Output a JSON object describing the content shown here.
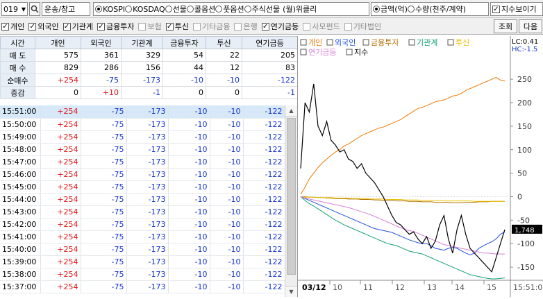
{
  "toolbar": {
    "code": "019",
    "sector": "운송/창고",
    "markets": [
      "KOSPI",
      "KOSDAQ",
      "선물",
      "콜옵션",
      "풋옵션",
      "주식선물",
      "(월)위클리"
    ],
    "selected_market": "KOSPI",
    "units": [
      "금액(억)",
      "수량(천주/계약)"
    ],
    "selected_unit": "금액(억)",
    "show_index_label": "지수보이기",
    "show_index_checked": true,
    "query_button": "조회",
    "next_button": "다음"
  },
  "investor_filters": [
    {
      "label": "개인",
      "checked": true
    },
    {
      "label": "외국인",
      "checked": true
    },
    {
      "label": "기관계",
      "checked": true
    },
    {
      "label": "금융투자",
      "checked": true
    },
    {
      "label": "보험",
      "checked": false
    },
    {
      "label": "투신",
      "checked": true
    },
    {
      "label": "기타금융",
      "checked": false
    },
    {
      "label": "은행",
      "checked": false
    },
    {
      "label": "연기금등",
      "checked": true
    },
    {
      "label": "사모펀드",
      "checked": false
    },
    {
      "label": "기타법인",
      "checked": false
    }
  ],
  "summary": {
    "headers": [
      "시간",
      "개인",
      "외국인",
      "기관계",
      "금융투자",
      "투신",
      "연기금등"
    ],
    "rows": [
      {
        "label": "매 도",
        "values": [
          "575",
          "361",
          "329",
          "54",
          "22",
          "205"
        ]
      },
      {
        "label": "매 수",
        "values": [
          "829",
          "286",
          "156",
          "44",
          "12",
          "83"
        ]
      },
      {
        "label": "순매수",
        "values": [
          "+254",
          "-75",
          "-173",
          "-10",
          "-10",
          "-122"
        ]
      },
      {
        "label": "증감",
        "values": [
          "0",
          "+10",
          "-1",
          "0",
          "0",
          "-1"
        ]
      }
    ]
  },
  "time_rows": {
    "times": [
      "15:51:00",
      "15:50:00",
      "15:49:00",
      "15:48:00",
      "15:47:00",
      "15:46:00",
      "15:45:00",
      "15:44:00",
      "15:43:00",
      "15:42:00",
      "15:41:00",
      "15:40:00",
      "15:39:00",
      "15:38:00",
      "15:37:00"
    ],
    "values": [
      "+254",
      "-75",
      "-173",
      "-10",
      "-10",
      "-122"
    ]
  },
  "chart_data": {
    "type": "line",
    "legend": [
      "개인",
      "외국인",
      "금융투자",
      "기관계",
      "투신",
      "연기금등",
      "지수"
    ],
    "colors": {
      "개인": "#f07800",
      "외국인": "#2050e0",
      "금융투자": "#b07000",
      "기관계": "#10a070",
      "투신": "#e8c000",
      "연기금등": "#d880d8",
      "지수": "#000000"
    },
    "right_info": [
      "LC:0.41",
      "HC:-1.5"
    ],
    "y_ticks": [
      250,
      200,
      150,
      100,
      50,
      0,
      -50,
      -100,
      -150
    ],
    "ylim": [
      -175,
      265
    ],
    "x_labels": [
      "03/12",
      "10",
      "11",
      "12",
      "13",
      "14",
      "15",
      "15:51:00"
    ],
    "current_index_label": "1,748",
    "series": [
      {
        "name": "개인",
        "values": [
          5,
          20,
          38,
          50,
          62,
          72,
          80,
          88,
          95,
          100,
          108,
          112,
          118,
          124,
          130,
          134,
          138,
          142,
          146,
          148,
          152,
          156,
          160,
          164,
          170,
          176,
          182,
          188,
          190,
          194,
          198,
          202,
          204,
          206,
          210,
          214,
          216,
          220,
          226,
          230,
          234,
          238,
          242,
          246,
          250,
          254,
          248,
          246
        ]
      },
      {
        "name": "외국인",
        "values": [
          0,
          -4,
          -8,
          -12,
          -16,
          -20,
          -24,
          -28,
          -32,
          -36,
          -40,
          -44,
          -48,
          -52,
          -56,
          -60,
          -64,
          -68,
          -70,
          -72,
          -74,
          -76,
          -80,
          -84,
          -88,
          -92,
          -95,
          -98,
          -100,
          -100,
          -104,
          -110,
          -112,
          -114,
          -110,
          -108,
          -110,
          -115,
          -120,
          -124,
          -120,
          -110,
          -105,
          -100,
          -96,
          -90,
          -80,
          -75
        ]
      },
      {
        "name": "금융투자",
        "values": [
          0,
          0,
          -1,
          -1,
          -2,
          -2,
          -3,
          -3,
          -4,
          -4,
          -4,
          -5,
          -5,
          -5,
          -6,
          -6,
          -6,
          -7,
          -7,
          -8,
          -8,
          -8,
          -9,
          -9,
          -9,
          -10,
          -10,
          -10,
          -11,
          -11,
          -11,
          -12,
          -12,
          -12,
          -12,
          -13,
          -13,
          -13,
          -12,
          -12,
          -12,
          -11,
          -11,
          -11,
          -10,
          -10,
          -10,
          -10
        ]
      },
      {
        "name": "기관계",
        "values": [
          0,
          -8,
          -15,
          -20,
          -26,
          -32,
          -38,
          -44,
          -50,
          -55,
          -60,
          -64,
          -68,
          -72,
          -76,
          -80,
          -84,
          -88,
          -92,
          -96,
          -100,
          -102,
          -104,
          -108,
          -112,
          -116,
          -118,
          -120,
          -122,
          -126,
          -130,
          -134,
          -138,
          -142,
          -146,
          -150,
          -154,
          -158,
          -162,
          -166,
          -168,
          -170,
          -172,
          -174,
          -175,
          -175,
          -174,
          -173
        ]
      },
      {
        "name": "투신",
        "values": [
          0,
          -1,
          -1,
          -1,
          -2,
          -2,
          -2,
          -2,
          -3,
          -3,
          -3,
          -3,
          -4,
          -4,
          -4,
          -4,
          -5,
          -5,
          -5,
          -5,
          -6,
          -6,
          -6,
          -6,
          -7,
          -7,
          -7,
          -7,
          -8,
          -8,
          -8,
          -8,
          -8,
          -9,
          -9,
          -9,
          -9,
          -9,
          -9,
          -9,
          -10,
          -10,
          -10,
          -10,
          -10,
          -10,
          -10,
          -10
        ]
      },
      {
        "name": "연기금등",
        "values": [
          0,
          -3,
          -5,
          -7,
          -9,
          -11,
          -13,
          -15,
          -17,
          -19,
          -21,
          -23,
          -26,
          -29,
          -32,
          -35,
          -38,
          -42,
          -46,
          -50,
          -54,
          -58,
          -62,
          -66,
          -70,
          -72,
          -74,
          -78,
          -82,
          -86,
          -90,
          -94,
          -98,
          -102,
          -104,
          -106,
          -108,
          -110,
          -112,
          -114,
          -116,
          -118,
          -120,
          -120,
          -121,
          -122,
          -122,
          -122
        ]
      },
      {
        "name": "지수",
        "values": [
          60,
          200,
          180,
          240,
          150,
          130,
          160,
          120,
          110,
          95,
          100,
          80,
          75,
          60,
          70,
          50,
          40,
          30,
          15,
          0,
          -20,
          -40,
          -55,
          -60,
          -70,
          -80,
          -75,
          -90,
          -100,
          -85,
          -110,
          -95,
          -60,
          -40,
          -90,
          -120,
          -70,
          -40,
          -80,
          -110,
          -120,
          -130,
          -140,
          -150,
          -160,
          -130,
          -100,
          -70
        ]
      }
    ]
  }
}
